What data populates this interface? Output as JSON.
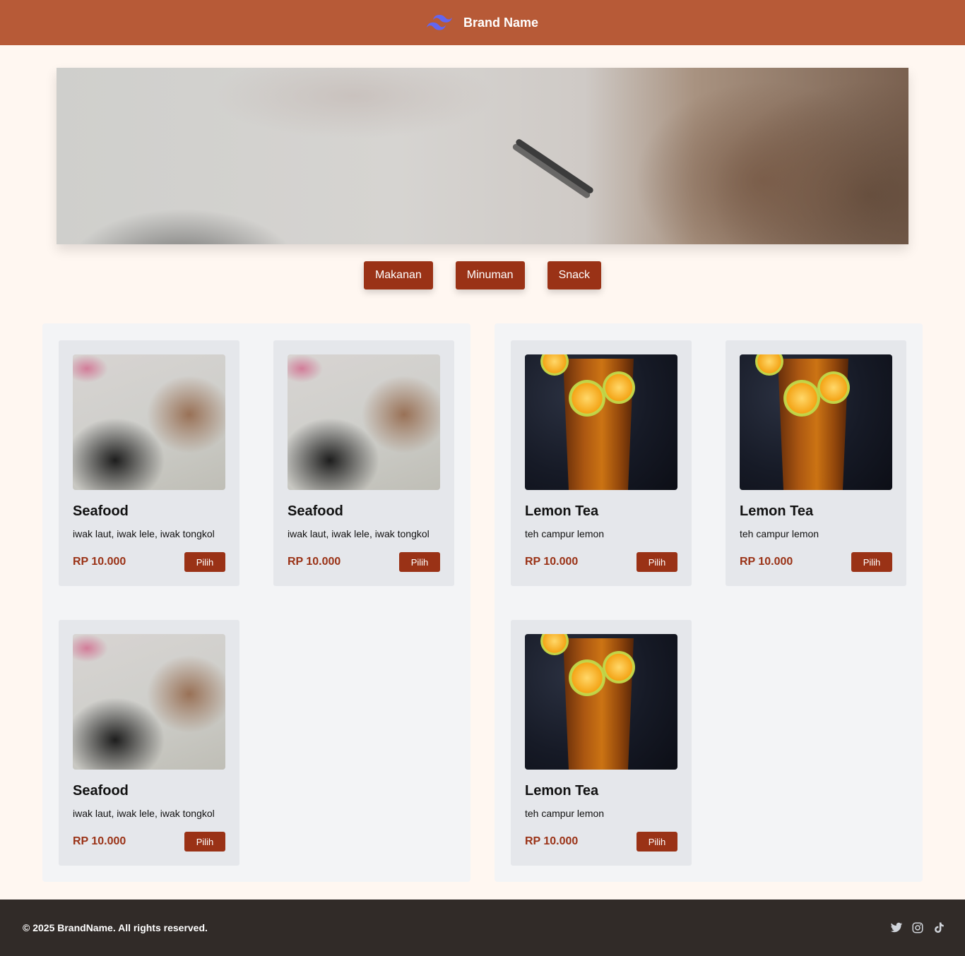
{
  "navbar": {
    "brand": "Brand Name",
    "logo_icon": "tailwind-logo-icon"
  },
  "categories": [
    "Makanan",
    "Minuman",
    "Snack"
  ],
  "menu": {
    "food": [
      {
        "name": "Seafood",
        "desc": "iwak laut, iwak lele, iwak tongkol",
        "price": "RP 10.000",
        "button": "Pilih"
      },
      {
        "name": "Seafood",
        "desc": "iwak laut, iwak lele, iwak tongkol",
        "price": "RP 10.000",
        "button": "Pilih"
      },
      {
        "name": "Seafood",
        "desc": "iwak laut, iwak lele, iwak tongkol",
        "price": "RP 10.000",
        "button": "Pilih"
      }
    ],
    "drinks": [
      {
        "name": "Lemon Tea",
        "desc": "teh campur lemon",
        "price": "RP 10.000",
        "button": "Pilih"
      },
      {
        "name": "Lemon Tea",
        "desc": "teh campur lemon",
        "price": "RP 10.000",
        "button": "Pilih"
      },
      {
        "name": "Lemon Tea",
        "desc": "teh campur lemon",
        "price": "RP 10.000",
        "button": "Pilih"
      }
    ]
  },
  "footer": {
    "copyright": "© 2025 BrandName. All rights reserved.",
    "socials": [
      "twitter-icon",
      "instagram-icon",
      "tiktok-icon"
    ]
  },
  "colors": {
    "navbar": "#b75a37",
    "accent": "#9a3216",
    "background": "#fff7f1",
    "footer": "#312b28"
  }
}
